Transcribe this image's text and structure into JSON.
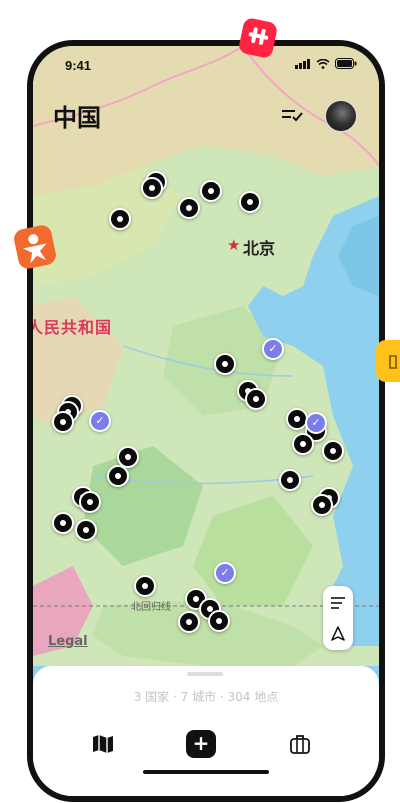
{
  "status_bar": {
    "time": "9:41"
  },
  "header": {
    "title": "中国"
  },
  "map": {
    "city_label": "北京",
    "country_label": "人民共和国",
    "tropic_label": "北回归线",
    "legal_label": "Legal"
  },
  "summary": {
    "stats_text": "3 国家 · 7 城市 · 304 地点"
  },
  "tab_bar": {
    "add_label": "+"
  },
  "colors": {
    "visited_pin": "#0b0b0b",
    "verified_pin": "#7b7de8",
    "sea": "#8fd0ee",
    "land": "#cfe7b8",
    "xiaohongshu": "#ff2442",
    "douyin_orange": "#f26a2e",
    "tag_yellow": "#ffc21a"
  },
  "icons": [
    "wifi-icon",
    "battery-icon",
    "signal-icon",
    "filter-icon",
    "avatar",
    "layers-icon",
    "location-arrow-icon",
    "map-icon",
    "add-icon",
    "suitcase-icon",
    "check-icon"
  ]
}
